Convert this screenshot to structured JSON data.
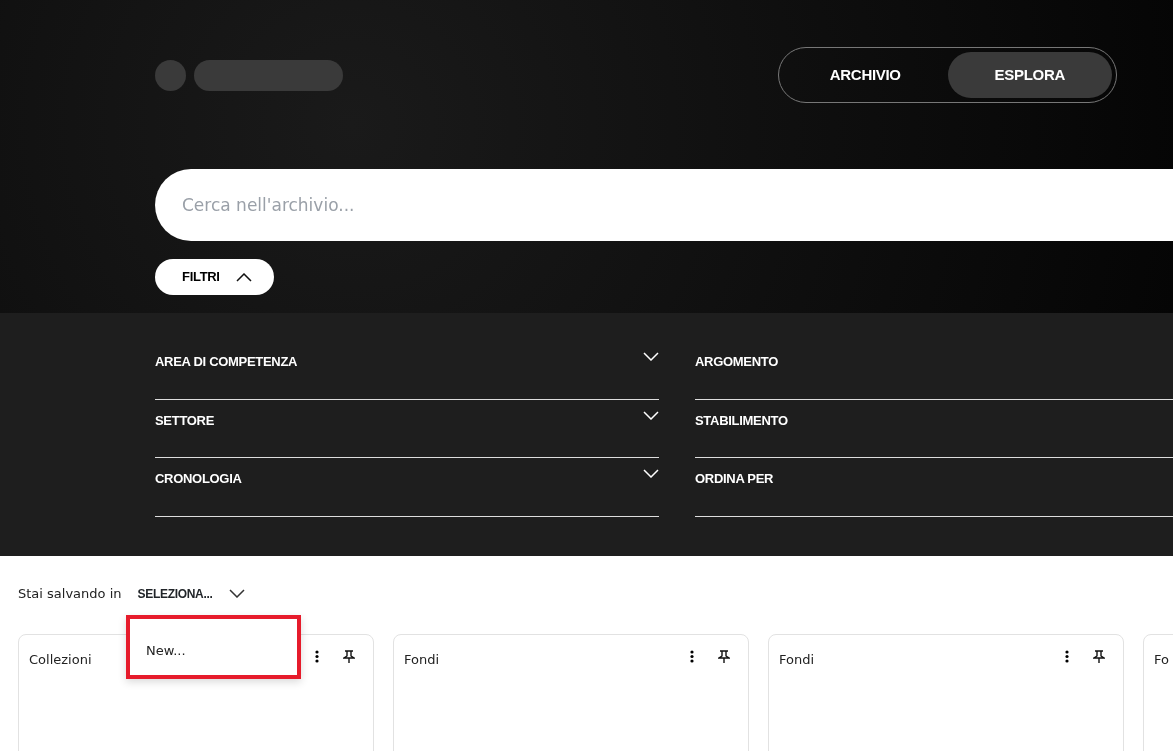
{
  "nav": {
    "tabs": [
      {
        "label": "ARCHIVIO",
        "selected": false
      },
      {
        "label": "ESPLORA",
        "selected": true
      }
    ]
  },
  "search": {
    "placeholder": "Cerca nell'archivio..."
  },
  "filters_toggle": {
    "label": "FILTRI",
    "expanded": true
  },
  "filters": [
    {
      "label": "AREA DI COMPETENZA",
      "chevron": true
    },
    {
      "label": "ARGOMENTO",
      "chevron": false
    },
    {
      "label": "SETTORE",
      "chevron": true
    },
    {
      "label": "STABILIMENTO",
      "chevron": false
    },
    {
      "label": "CRONOLOGIA",
      "chevron": true
    },
    {
      "label": "ORDINA PER",
      "chevron": false
    }
  ],
  "saving": {
    "label": "Stai salvando in",
    "value": "SELEZIONA..."
  },
  "dropdown": {
    "highlighted": true,
    "items": [
      {
        "label": "New..."
      }
    ]
  },
  "cards": [
    {
      "title": "Collezioni",
      "actions": true
    },
    {
      "title": "Fondi",
      "actions": true
    },
    {
      "title": "Fondi",
      "actions": true
    },
    {
      "title": "Fo"
    }
  ]
}
